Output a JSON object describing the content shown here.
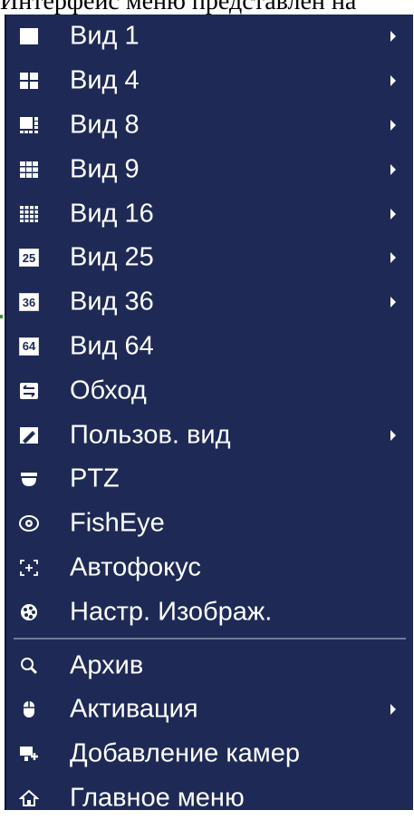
{
  "caption": "Интерфейс меню представлен на",
  "menu": {
    "items_top": [
      {
        "label": "Вид 1",
        "icon": "view-1-icon",
        "has_submenu": true
      },
      {
        "label": "Вид 4",
        "icon": "view-4-icon",
        "has_submenu": true
      },
      {
        "label": "Вид 8",
        "icon": "view-8-icon",
        "has_submenu": true
      },
      {
        "label": "Вид 9",
        "icon": "view-9-icon",
        "has_submenu": true
      },
      {
        "label": "Вид 16",
        "icon": "view-16-icon",
        "has_submenu": true
      },
      {
        "label": "Вид 25",
        "icon": "view-25-icon",
        "icon_text": "25",
        "has_submenu": true
      },
      {
        "label": "Вид 36",
        "icon": "view-36-icon",
        "icon_text": "36",
        "has_submenu": true
      },
      {
        "label": "Вид 64",
        "icon": "view-64-icon",
        "icon_text": "64",
        "has_submenu": false
      },
      {
        "label": "Обход",
        "icon": "tour-icon",
        "has_submenu": false
      },
      {
        "label": "Пользов. вид",
        "icon": "custom-view-icon",
        "has_submenu": true
      },
      {
        "label": "PTZ",
        "icon": "ptz-icon",
        "has_submenu": false
      },
      {
        "label": "FishEye",
        "icon": "fisheye-icon",
        "has_submenu": false
      },
      {
        "label": "Автофокус",
        "icon": "autofocus-icon",
        "has_submenu": false
      },
      {
        "label": "Настр. Изображ.",
        "icon": "image-settings-icon",
        "has_submenu": false
      }
    ],
    "items_bottom": [
      {
        "label": "Архив",
        "icon": "search-icon",
        "has_submenu": false
      },
      {
        "label": "Активация",
        "icon": "mouse-icon",
        "has_submenu": true
      },
      {
        "label": "Добавление камер",
        "icon": "add-camera-icon",
        "has_submenu": false
      },
      {
        "label": "Главное меню",
        "icon": "home-icon",
        "has_submenu": false
      }
    ]
  },
  "colors": {
    "menu_bg": "#1e2a55",
    "text": "#ffffff",
    "divider": "#6d7a99"
  }
}
